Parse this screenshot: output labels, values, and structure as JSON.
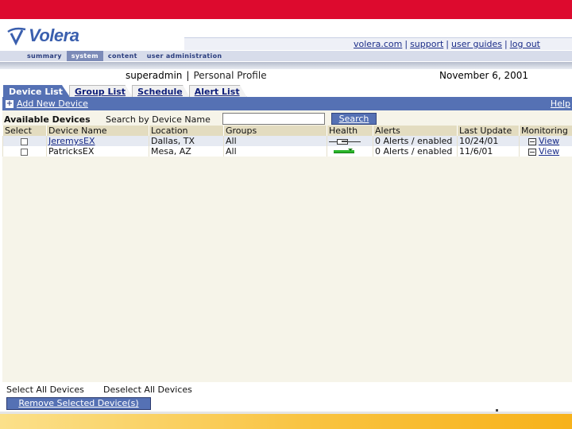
{
  "brand": {
    "name": "Volera",
    "accent": "#dd0a2e",
    "primary": "#5571b4"
  },
  "utility_links": [
    "volera.com",
    "support",
    "user guides",
    "log out"
  ],
  "nav": [
    "summary",
    "system",
    "content",
    "user administration"
  ],
  "nav_active": "system",
  "profile": {
    "user": "superadmin",
    "link": "Personal Profile"
  },
  "date": "November 6, 2001",
  "tabs": [
    "Device List",
    "Group List",
    "Schedule",
    "Alert List"
  ],
  "active_tab": "Device List",
  "toolbar": {
    "add_label": "Add New Device",
    "help_label": "Help"
  },
  "search": {
    "section_label": "Available Devices",
    "label": "Search by Device Name",
    "value": "",
    "button": "Search"
  },
  "table": {
    "headers": [
      "Select",
      "Device Name",
      "Location",
      "Groups",
      "Health",
      "Alerts",
      "Last Update",
      "Monitoring"
    ],
    "rows": [
      {
        "name": "JeremysEX",
        "location": "Dallas, TX",
        "groups": "All",
        "health": "warning",
        "alerts": "0 Alerts / enabled",
        "last_update": "10/24/01",
        "monitoring": "View"
      },
      {
        "name": "PatricksEX",
        "location": "Mesa, AZ",
        "groups": "All",
        "health": "ok",
        "alerts": "0 Alerts / enabled",
        "last_update": "11/6/01",
        "monitoring": "View"
      }
    ]
  },
  "footer": {
    "select_all": "Select All Devices",
    "deselect_all": "Deselect All Devices",
    "remove_button": "Remove Selected Device(s)"
  }
}
